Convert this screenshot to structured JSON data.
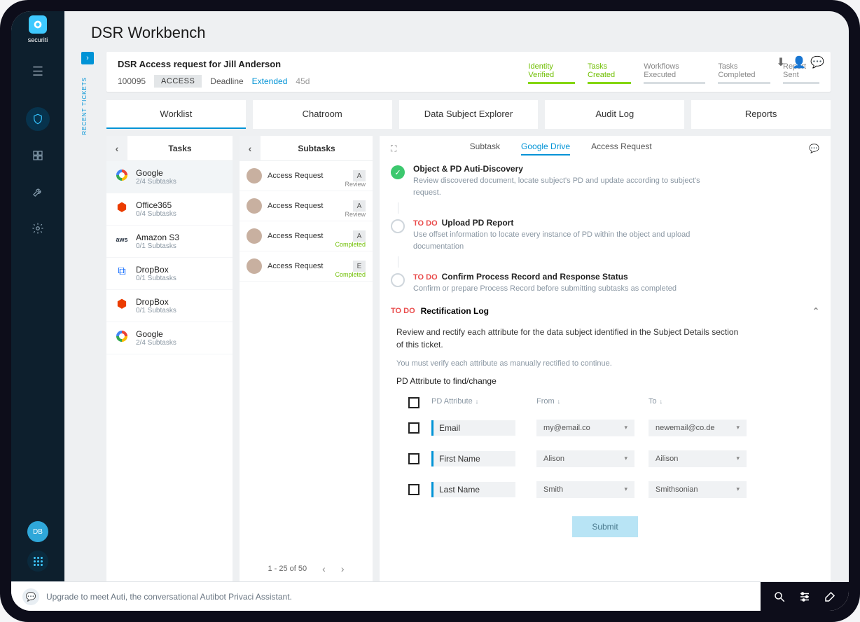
{
  "brand": {
    "name": "securiti"
  },
  "page_title": "DSR Workbench",
  "recent_tickets_label": "RECENT TICKETS",
  "ticket": {
    "title": "DSR Access request for Jill Anderson",
    "id": "100095",
    "type": "ACCESS",
    "deadline_label": "Deadline",
    "extended_label": "Extended",
    "days": "45d"
  },
  "stages": [
    {
      "label": "Identity Verified",
      "done": true
    },
    {
      "label": "Tasks Created",
      "done": true
    },
    {
      "label": "Workflows Executed",
      "done": false
    },
    {
      "label": "Tasks Completed",
      "done": false
    },
    {
      "label": "Report Sent",
      "done": false
    }
  ],
  "tabs": [
    "Worklist",
    "Chatroom",
    "Data Subject Explorer",
    "Audit Log",
    "Reports"
  ],
  "tasks": {
    "header": "Tasks",
    "items": [
      {
        "name": "Google",
        "sub": "2/4 Subtasks",
        "service": "google"
      },
      {
        "name": "Office365",
        "sub": "0/4 Subtasks",
        "service": "office"
      },
      {
        "name": "Amazon S3",
        "sub": "0/1 Subtasks",
        "service": "aws"
      },
      {
        "name": "DropBox",
        "sub": "0/1 Subtasks",
        "service": "dropbox"
      },
      {
        "name": "DropBox",
        "sub": "0/1 Subtasks",
        "service": "office"
      },
      {
        "name": "Google",
        "sub": "2/4 Subtasks",
        "service": "google"
      }
    ]
  },
  "subtasks": {
    "header": "Subtasks",
    "items": [
      {
        "label": "Access Request",
        "badge": "A",
        "status": "Review",
        "status_class": "review"
      },
      {
        "label": "Access Request",
        "badge": "A",
        "status": "Review",
        "status_class": "review"
      },
      {
        "label": "Access Request",
        "badge": "A",
        "status": "Completed",
        "status_class": "done"
      },
      {
        "label": "Access Request",
        "badge": "E",
        "status": "Completed",
        "status_class": "done"
      }
    ],
    "pagination": "1 - 25 of 50"
  },
  "detail": {
    "tabs": {
      "subtask": "Subtask",
      "gdrive": "Google Drive",
      "access": "Access Request"
    },
    "steps": [
      {
        "type": "done",
        "title": "Object & PD Auti-Discovery",
        "desc": "Review discovered document, locate subject's PD and update according to subject's request."
      },
      {
        "type": "todo",
        "todo": "TO DO",
        "title": "Upload PD Report",
        "desc": "Use offset information to locate every instance of PD within the object and upload documentation"
      },
      {
        "type": "todo",
        "todo": "TO DO",
        "title": "Confirm Process Record and Response Status",
        "desc": "Confirm or prepare Process Record before submitting subtasks as completed"
      }
    ],
    "rectification": {
      "todo": "TO DO",
      "title": "Rectification Log",
      "desc": "Review and rectify each attribute for the data subject identified in the Subject Details section of this ticket.",
      "note": "You must verify each attribute as manually rectified to continue.",
      "subhead": "PD Attribute to find/change",
      "headers": {
        "attr": "PD Attribute",
        "from": "From",
        "to": "To"
      },
      "rows": [
        {
          "attr": "Email",
          "from": "my@email.co",
          "to": "newemail@co.de"
        },
        {
          "attr": "First Name",
          "from": "Alison",
          "to": "Ailison"
        },
        {
          "attr": "Last Name",
          "from": "Smith",
          "to": "Smithsonian"
        }
      ],
      "submit": "Submit"
    }
  },
  "footer": {
    "text": "Upgrade to meet Auti, the conversational Autibot Privaci Assistant."
  },
  "user_initials": "DB"
}
